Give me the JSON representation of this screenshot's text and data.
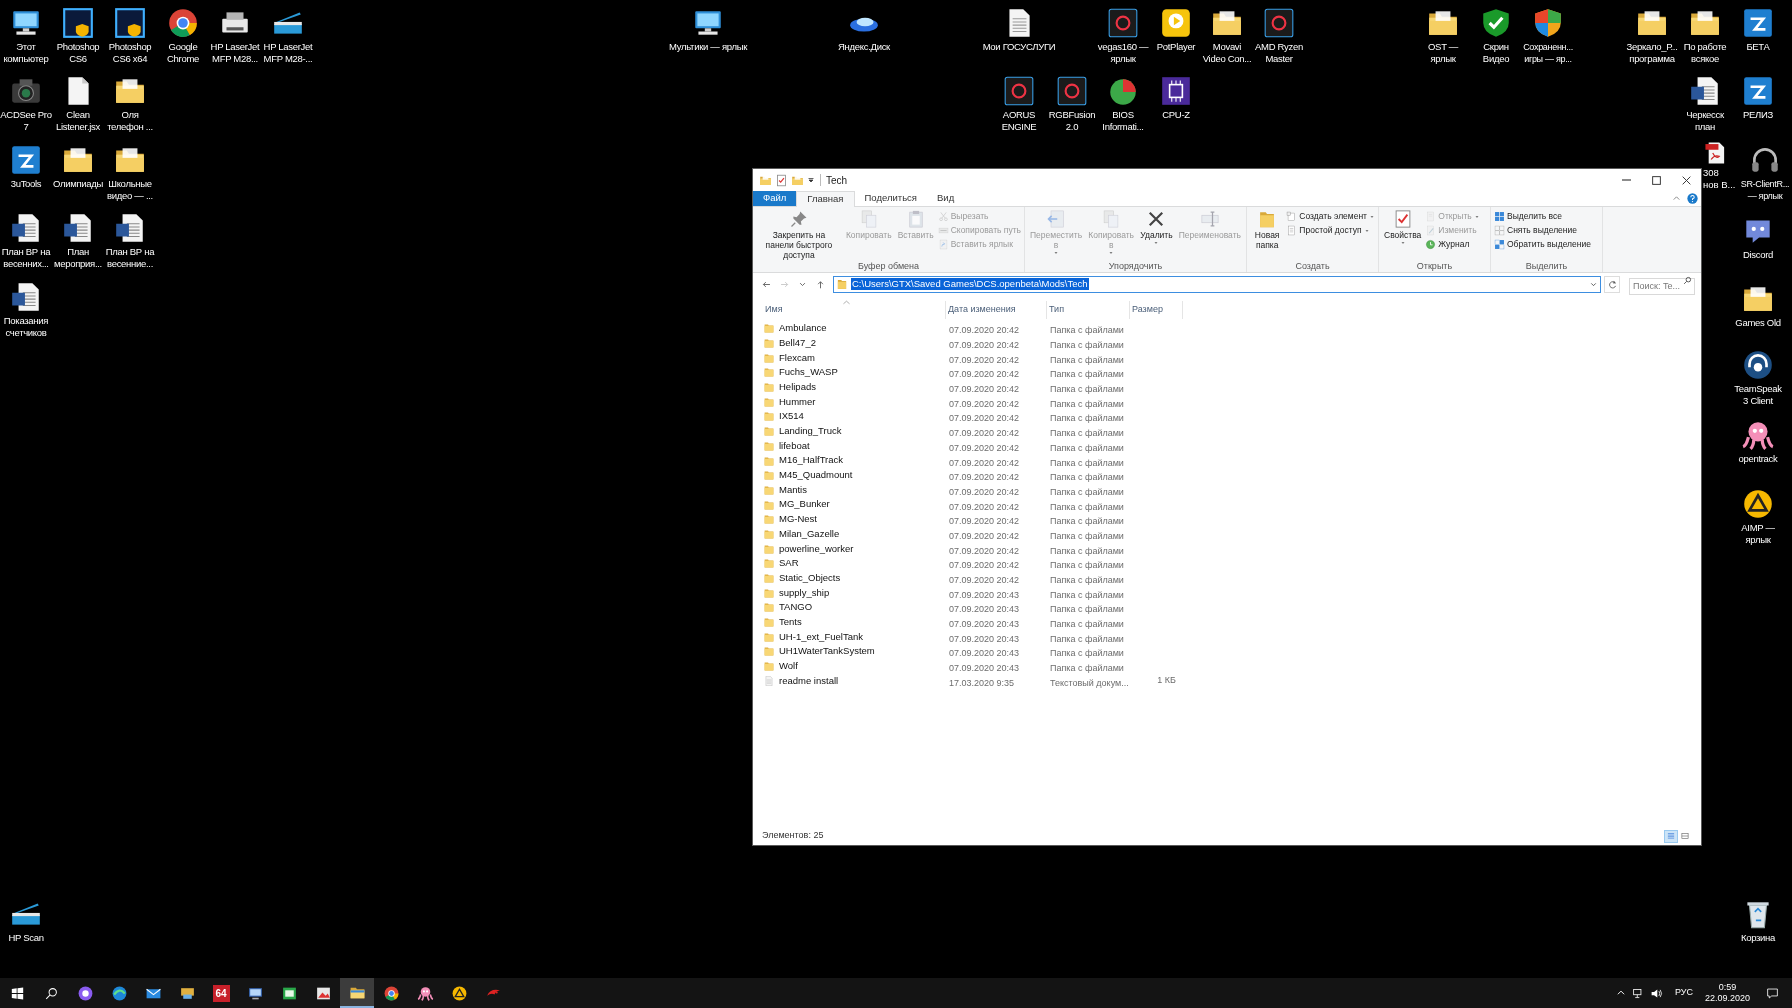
{
  "desktop_icons": [
    {
      "label": "Этот компьютер",
      "kind": "monitor"
    },
    {
      "label": "Photoshop CS6",
      "kind": "ps"
    },
    {
      "label": "Photoshop CS6 x64",
      "kind": "ps"
    },
    {
      "label": "Google Chrome",
      "kind": "chrome"
    },
    {
      "label": "HP LaserJet MFP M28...",
      "kind": "printer"
    },
    {
      "label": "HP LaserJet MFP M28-...",
      "kind": "scanner"
    },
    {
      "label": "ACDSee Pro 7",
      "kind": "camera"
    },
    {
      "label": "Clean Listener.jsx",
      "kind": "file"
    },
    {
      "label": "Оля телефон ...",
      "kind": "folder"
    },
    {
      "label": "3uTools",
      "kind": "tile_blue"
    },
    {
      "label": "Олимпиады",
      "kind": "folder"
    },
    {
      "label": "Школьные видео — ...",
      "kind": "folder"
    },
    {
      "label": "План ВР на весенних...",
      "kind": "word"
    },
    {
      "label": "План мероприя...",
      "kind": "word"
    },
    {
      "label": "План ВР на весенние...",
      "kind": "word"
    },
    {
      "label": "Показания счетчиков",
      "kind": "word"
    },
    {
      "label": "Мультики — ярлык",
      "kind": "monitor"
    },
    {
      "label": "Яндекс.Диск",
      "kind": "saucer"
    },
    {
      "label": "Мои ГОСУСЛУГИ",
      "kind": "textfile"
    },
    {
      "label": "vegas160 — ярлык",
      "kind": "tile_dark"
    },
    {
      "label": "PotPlayer",
      "kind": "tile_yellow"
    },
    {
      "label": "Movavi Video Con...",
      "kind": "folder"
    },
    {
      "label": "AMD Ryzen Master",
      "kind": "tile_dark"
    },
    {
      "label": "AORUS ENGINE",
      "kind": "tile_dark"
    },
    {
      "label": "RGBFusion 2.0",
      "kind": "tile_dark"
    },
    {
      "label": "BIOS Informati...",
      "kind": "pie"
    },
    {
      "label": "CPU-Z",
      "kind": "tile_purple"
    },
    {
      "label": "OST — ярлык",
      "kind": "folder"
    },
    {
      "label": "Скрин Видео",
      "kind": "shield_green"
    },
    {
      "label": "Сохраненн... игры — яр...",
      "kind": "shield_color"
    },
    {
      "label": "Зеркало_Р... программа",
      "kind": "folder"
    },
    {
      "label": "По работе всякое",
      "kind": "folder"
    },
    {
      "label": "БЕТА",
      "kind": "tile_blue"
    },
    {
      "label": "Черкесск план",
      "kind": "word"
    },
    {
      "label": "РЕЛИЗ",
      "kind": "tile_blue"
    },
    {
      "label": "308 нов В...",
      "kind": "pdf"
    },
    {
      "label": "SR-ClientR... — ярлык",
      "kind": "headset"
    },
    {
      "label": "Discord",
      "kind": "chat"
    },
    {
      "label": "Games Old",
      "kind": "folder"
    },
    {
      "label": "TeamSpeak 3 Client",
      "kind": "headset_round"
    },
    {
      "label": "opentrack",
      "kind": "octopus"
    },
    {
      "label": "AIMP — ярлык",
      "kind": "triangle"
    },
    {
      "label": "HP Scan",
      "kind": "scanner"
    },
    {
      "label": "Корзина",
      "kind": "bin"
    }
  ],
  "window": {
    "title": "Tech",
    "tabs": [
      {
        "label": "Файл",
        "kind": "menu",
        "selected": false
      },
      {
        "label": "Главная",
        "kind": "tab",
        "selected": true
      },
      {
        "label": "Поделиться",
        "kind": "tab",
        "selected": false
      },
      {
        "label": "Вид",
        "kind": "tab",
        "selected": false
      }
    ],
    "ribbon": [
      {
        "label": "Буфер обмена",
        "items": [
          {
            "kind": "large",
            "label": "Закрепить на панели быстрого доступа",
            "disabled": false,
            "dropdown": false
          },
          {
            "kind": "large",
            "label": "Копировать",
            "disabled": true,
            "dropdown": false
          },
          {
            "kind": "large",
            "label": "Вставить",
            "disabled": true,
            "dropdown": false
          },
          {
            "kind": "small",
            "label": "Вырезать",
            "disabled": true,
            "dropdown": false
          },
          {
            "kind": "small",
            "label": "Скопировать путь",
            "disabled": true,
            "dropdown": false
          },
          {
            "kind": "small",
            "label": "Вставить ярлык",
            "disabled": true,
            "dropdown": false
          }
        ]
      },
      {
        "label": "Упорядочить",
        "items": [
          {
            "kind": "large",
            "label": "Переместить в",
            "disabled": true,
            "dropdown": true
          },
          {
            "kind": "large",
            "label": "Копировать в",
            "disabled": true,
            "dropdown": true
          },
          {
            "kind": "large",
            "label": "Удалить",
            "disabled": false,
            "dropdown": true
          },
          {
            "kind": "large",
            "label": "Переименовать",
            "disabled": true,
            "dropdown": false
          }
        ]
      },
      {
        "label": "Создать",
        "items": [
          {
            "kind": "large",
            "label": "Новая папка",
            "disabled": false,
            "dropdown": false
          },
          {
            "kind": "small",
            "label": "Создать элемент",
            "disabled": false,
            "dropdown": true
          },
          {
            "kind": "small",
            "label": "Простой доступ",
            "disabled": false,
            "dropdown": true
          }
        ]
      },
      {
        "label": "Открыть",
        "items": [
          {
            "kind": "large",
            "label": "Свойства",
            "disabled": false,
            "dropdown": true
          },
          {
            "kind": "small",
            "label": "Открыть",
            "disabled": true,
            "dropdown": true
          },
          {
            "kind": "small",
            "label": "Изменить",
            "disabled": true,
            "dropdown": false
          },
          {
            "kind": "small",
            "label": "Журнал",
            "disabled": false,
            "dropdown": false
          }
        ]
      },
      {
        "label": "Выделить",
        "items": [
          {
            "kind": "small",
            "label": "Выделить все",
            "disabled": false,
            "dropdown": false
          },
          {
            "kind": "small",
            "label": "Снять выделение",
            "disabled": false,
            "dropdown": false
          },
          {
            "kind": "small",
            "label": "Обратить выделение",
            "disabled": false,
            "dropdown": false
          }
        ]
      }
    ],
    "address": {
      "path": "C:\\Users\\GTX\\Saved Games\\DCS.openbeta\\Mods\\Tech",
      "selected": true
    },
    "search": {
      "placeholder": "Поиск: Te..."
    },
    "columns": [
      "Имя",
      "Дата изменения",
      "Тип",
      "Размер"
    ],
    "rows": [
      {
        "kind": "folder",
        "name": "Ambulance",
        "date": "07.09.2020 20:42",
        "type": "Папка с файлами"
      },
      {
        "kind": "folder",
        "name": "Bell47_2",
        "date": "07.09.2020 20:42",
        "type": "Папка с файлами"
      },
      {
        "kind": "folder",
        "name": "Flexcam",
        "date": "07.09.2020 20:42",
        "type": "Папка с файлами"
      },
      {
        "kind": "folder",
        "name": "Fuchs_WASP",
        "date": "07.09.2020 20:42",
        "type": "Папка с файлами"
      },
      {
        "kind": "folder",
        "name": "Helipads",
        "date": "07.09.2020 20:42",
        "type": "Папка с файлами"
      },
      {
        "kind": "folder",
        "name": "Hummer",
        "date": "07.09.2020 20:42",
        "type": "Папка с файлами"
      },
      {
        "kind": "folder",
        "name": "IX514",
        "date": "07.09.2020 20:42",
        "type": "Папка с файлами"
      },
      {
        "kind": "folder",
        "name": "Landing_Truck",
        "date": "07.09.2020 20:42",
        "type": "Папка с файлами"
      },
      {
        "kind": "folder",
        "name": "lifeboat",
        "date": "07.09.2020 20:42",
        "type": "Папка с файлами"
      },
      {
        "kind": "folder",
        "name": "M16_HalfTrack",
        "date": "07.09.2020 20:42",
        "type": "Папка с файлами"
      },
      {
        "kind": "folder",
        "name": "M45_Quadmount",
        "date": "07.09.2020 20:42",
        "type": "Папка с файлами"
      },
      {
        "kind": "folder",
        "name": "Mantis",
        "date": "07.09.2020 20:42",
        "type": "Папка с файлами"
      },
      {
        "kind": "folder",
        "name": "MG_Bunker",
        "date": "07.09.2020 20:42",
        "type": "Папка с файлами"
      },
      {
        "kind": "folder",
        "name": "MG-Nest",
        "date": "07.09.2020 20:42",
        "type": "Папка с файлами"
      },
      {
        "kind": "folder",
        "name": "Milan_Gazelle",
        "date": "07.09.2020 20:42",
        "type": "Папка с файлами"
      },
      {
        "kind": "folder",
        "name": "powerline_worker",
        "date": "07.09.2020 20:42",
        "type": "Папка с файлами"
      },
      {
        "kind": "folder",
        "name": "SAR",
        "date": "07.09.2020 20:42",
        "type": "Папка с файлами"
      },
      {
        "kind": "folder",
        "name": "Static_Objects",
        "date": "07.09.2020 20:42",
        "type": "Папка с файлами"
      },
      {
        "kind": "folder",
        "name": "supply_ship",
        "date": "07.09.2020 20:43",
        "type": "Папка с файлами"
      },
      {
        "kind": "folder",
        "name": "TANGO",
        "date": "07.09.2020 20:43",
        "type": "Папка с файлами"
      },
      {
        "kind": "folder",
        "name": "Tents",
        "date": "07.09.2020 20:43",
        "type": "Папка с файлами"
      },
      {
        "kind": "folder",
        "name": "UH-1_ext_FuelTank",
        "date": "07.09.2020 20:43",
        "type": "Папка с файлами"
      },
      {
        "kind": "folder",
        "name": "UH1WaterTankSystem",
        "date": "07.09.2020 20:43",
        "type": "Папка с файлами"
      },
      {
        "kind": "folder",
        "name": "Wolf",
        "date": "07.09.2020 20:43",
        "type": "Папка с файлами"
      },
      {
        "kind": "file",
        "name": "readme install",
        "date": "17.03.2020 9:35",
        "type": "Текстовый докум...",
        "size": "1 КБ"
      }
    ],
    "status": "Элементов: 25",
    "view_buttons": [
      {
        "kind": "details",
        "selected": true
      },
      {
        "kind": "tiles",
        "selected": false
      }
    ]
  },
  "taskbar": {
    "apps": [
      {
        "kind": "assistant",
        "selected": false
      },
      {
        "kind": "browser_wave",
        "selected": false
      },
      {
        "kind": "mail",
        "selected": false
      },
      {
        "kind": "network",
        "selected": false
      },
      {
        "kind": "badge",
        "label": "64",
        "selected": false
      },
      {
        "kind": "remote",
        "selected": false
      },
      {
        "kind": "green",
        "selected": false
      },
      {
        "kind": "photo",
        "selected": false
      },
      {
        "kind": "explorer",
        "selected": true
      },
      {
        "kind": "chrome",
        "selected": false
      },
      {
        "kind": "octopus",
        "selected": false
      },
      {
        "kind": "triangle",
        "selected": false
      },
      {
        "kind": "dragon",
        "selected": false
      }
    ],
    "language": "РУС",
    "time": "0:59",
    "date": "22.09.2020"
  }
}
